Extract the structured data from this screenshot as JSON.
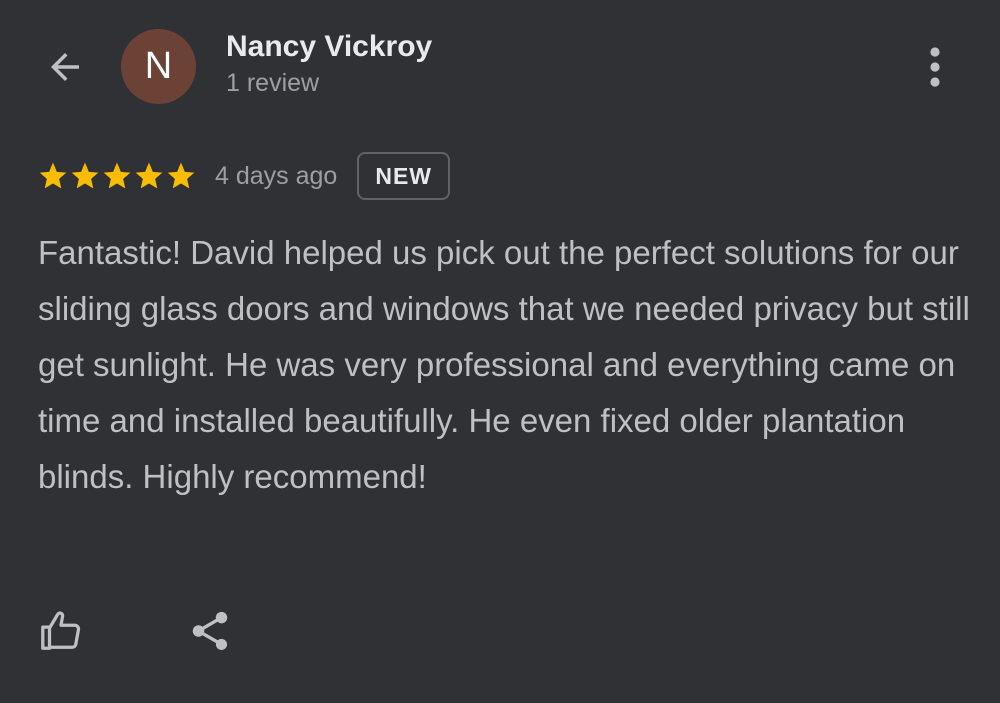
{
  "header": {
    "back_icon": "arrow-back-icon",
    "more_icon": "more-vert-icon"
  },
  "reviewer": {
    "initial": "N",
    "avatar_color": "#6d4236",
    "name": "Nancy Vickroy",
    "review_count": "1 review"
  },
  "review": {
    "rating": 5,
    "max_rating": 5,
    "star_color": "#fbbc04",
    "time_ago": "4 days ago",
    "badge": "NEW",
    "text": "Fantastic! David helped us pick out the perfect solutions for our sliding glass doors and windows that we needed privacy but still get sunlight. He was very professional and everything came on time and installed beautifully. He even fixed older plantation blinds. Highly recommend!"
  },
  "actions": {
    "like_icon": "thumb-up-icon",
    "share_icon": "share-icon"
  }
}
